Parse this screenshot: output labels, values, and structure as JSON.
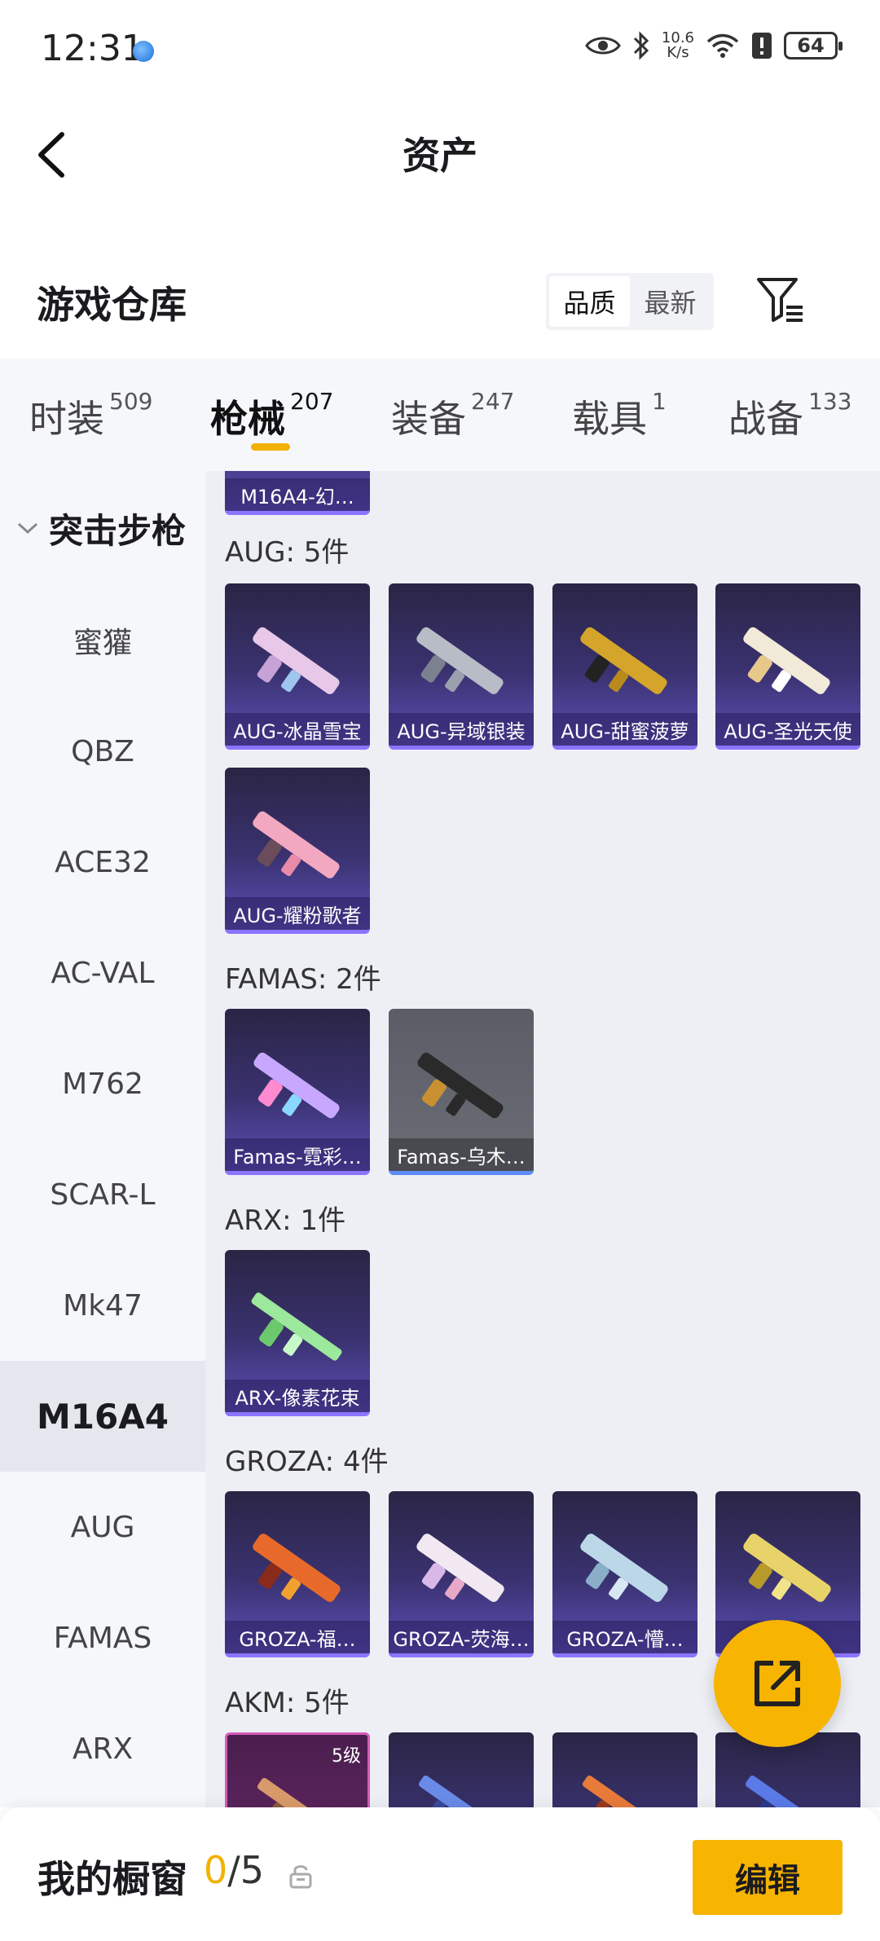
{
  "status_bar": {
    "time": "12:31",
    "speed_value": "10.6",
    "speed_unit": "K/s",
    "battery": "64"
  },
  "header": {
    "title": "资产"
  },
  "section": {
    "title": "游戏仓库",
    "sort_options": [
      "品质",
      "最新"
    ],
    "sort_selected": "品质"
  },
  "category_tabs": [
    {
      "label": "时装",
      "count": "509"
    },
    {
      "label": "枪械",
      "count": "207",
      "active": true
    },
    {
      "label": "装备",
      "count": "247"
    },
    {
      "label": "载具",
      "count": "1"
    },
    {
      "label": "战备",
      "count": "133"
    }
  ],
  "side_nav": {
    "group": "突击步枪",
    "items": [
      "蜜獾",
      "QBZ",
      "ACE32",
      "AC-VAL",
      "M762",
      "SCAR-L",
      "Mk47",
      "M16A4",
      "AUG",
      "FAMAS",
      "ARX"
    ],
    "active": "M16A4"
  },
  "groups": [
    {
      "title": "",
      "items": [
        {
          "name": "M16A4-幻…"
        }
      ]
    },
    {
      "title": "AUG: 5件",
      "items": [
        {
          "name": "AUG-冰晶雪宝"
        },
        {
          "name": "AUG-异域银装"
        },
        {
          "name": "AUG-甜蜜菠萝"
        },
        {
          "name": "AUG-圣光天使"
        },
        {
          "name": "AUG-耀粉歌者"
        }
      ]
    },
    {
      "title": "FAMAS: 2件",
      "items": [
        {
          "name": "Famas-霓彩…"
        },
        {
          "name": "Famas-乌木…"
        }
      ]
    },
    {
      "title": "ARX: 1件",
      "items": [
        {
          "name": "ARX-像素花束"
        }
      ]
    },
    {
      "title": "GROZA: 4件",
      "items": [
        {
          "name": "GROZA-福…"
        },
        {
          "name": "GROZA-荧海…"
        },
        {
          "name": "GROZA-懵…"
        },
        {
          "name": "G…同…"
        }
      ]
    },
    {
      "title": "AKM: 5件",
      "items": [
        {
          "name": "",
          "level": "5级"
        },
        {
          "name": ""
        },
        {
          "name": ""
        },
        {
          "name": ""
        }
      ]
    }
  ],
  "showcase": {
    "title": "我的橱窗",
    "current": "0",
    "separator": "/5"
  },
  "edit_button": "编辑",
  "colors": {
    "accent": "#f7b400",
    "skin_border": "#8b74ff",
    "nav_bg": "#f5f7fb",
    "grid_bg": "#edeff4"
  },
  "icons": {
    "back": "chevron-left-icon",
    "filter": "filter-icon",
    "share": "external-link-icon",
    "lock": "lock-icon"
  }
}
